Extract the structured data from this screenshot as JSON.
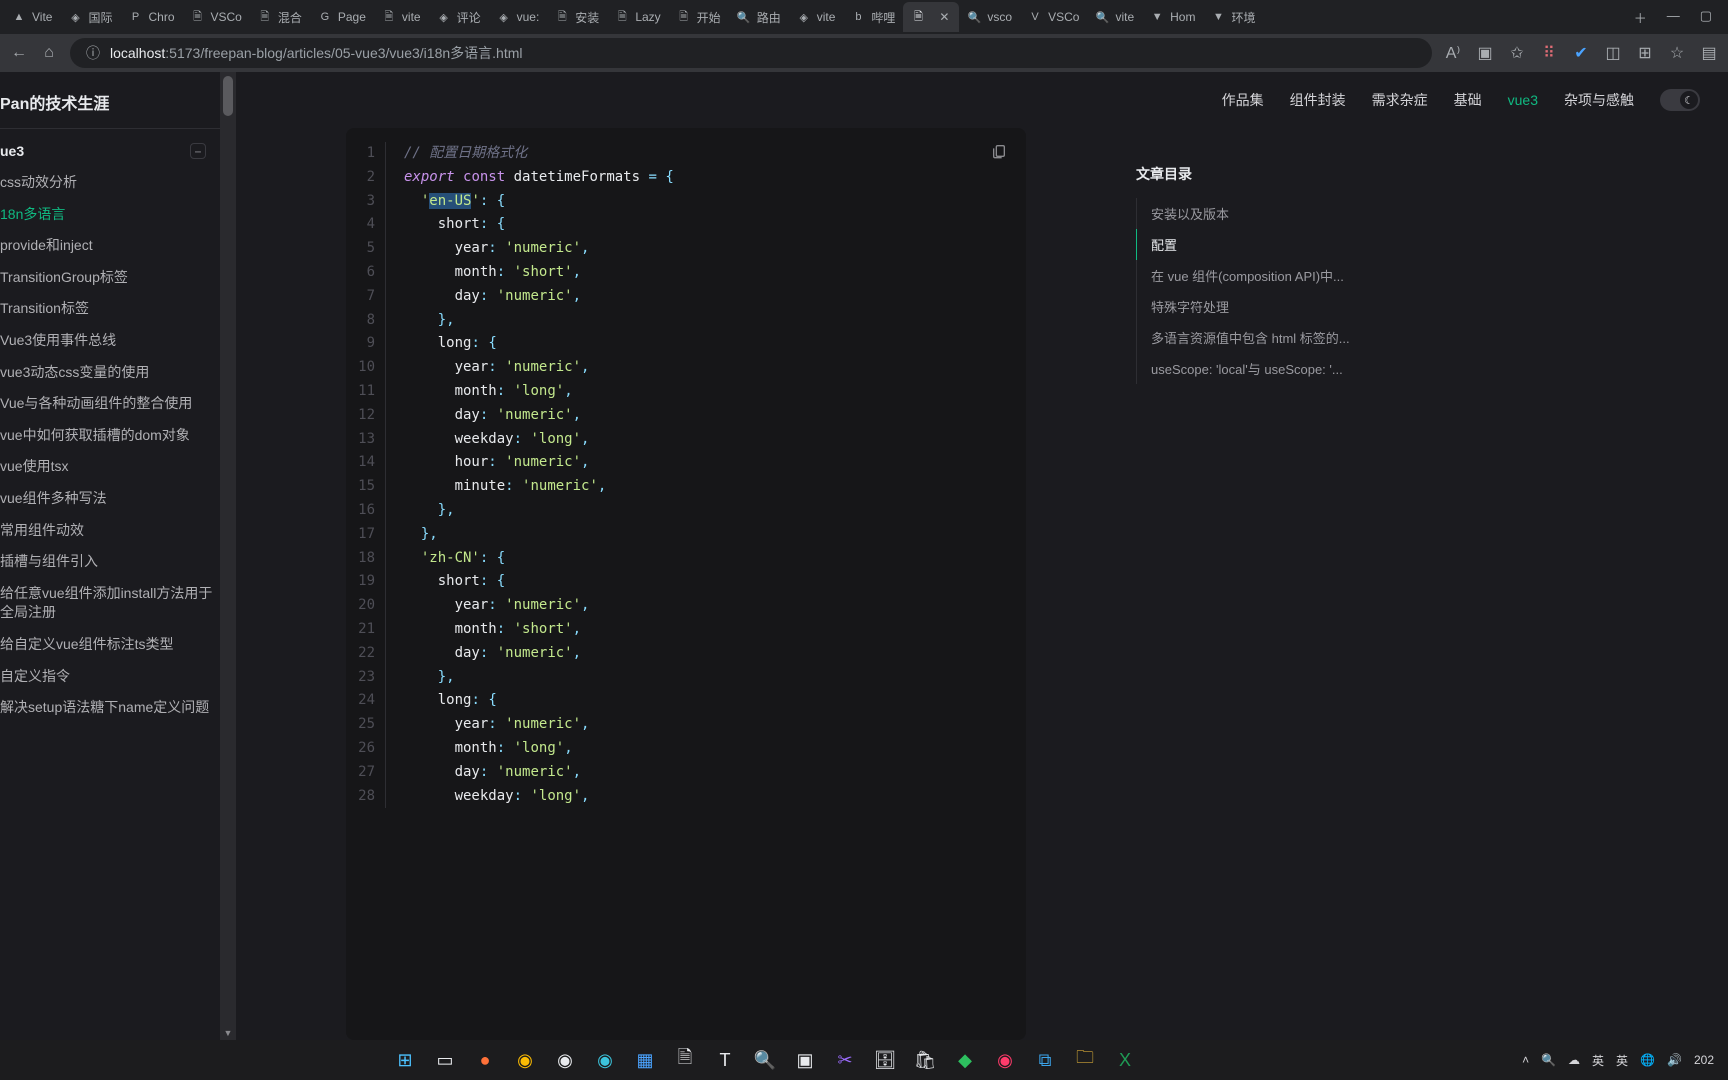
{
  "browser": {
    "tabs": [
      {
        "icon": "▲",
        "label": "Vite"
      },
      {
        "icon": "◈",
        "label": "国际"
      },
      {
        "icon": "P",
        "label": "Chro"
      },
      {
        "icon": "🗎",
        "label": "VSCo"
      },
      {
        "icon": "🗎",
        "label": "混合"
      },
      {
        "icon": "G",
        "label": "Page"
      },
      {
        "icon": "🗎",
        "label": "vite"
      },
      {
        "icon": "◈",
        "label": "评论"
      },
      {
        "icon": "◈",
        "label": "vue:"
      },
      {
        "icon": "🗎",
        "label": "安装"
      },
      {
        "icon": "🗎",
        "label": "Lazy"
      },
      {
        "icon": "🗎",
        "label": "开始"
      },
      {
        "icon": "🔍",
        "label": "路由"
      },
      {
        "icon": "◈",
        "label": "vite"
      },
      {
        "icon": "b",
        "label": "哔哩"
      },
      {
        "icon": "🗎",
        "label": "",
        "active": true,
        "closable": true
      },
      {
        "icon": "🔍",
        "label": "vsco"
      },
      {
        "icon": "V",
        "label": "VSCo"
      },
      {
        "icon": "🔍",
        "label": "vite"
      },
      {
        "icon": "▼",
        "label": "Hom"
      },
      {
        "icon": "▼",
        "label": "环境"
      }
    ],
    "url_host": "localhost",
    "url_port": ":5173",
    "url_path": "/freepan-blog/articles/05-vue3/vue3/i18n多语言.html"
  },
  "site_title": "Pan的技术生涯",
  "sidebar_group": "ue3",
  "sidebar_items": [
    "css动效分析",
    "18n多语言",
    "provide和inject",
    "TransitionGroup标签",
    "Transition标签",
    "Vue3使用事件总线",
    "vue3动态css变量的使用",
    "Vue与各种动画组件的整合使用",
    "vue中如何获取插槽的dom对象",
    "vue使用tsx",
    "vue组件多种写法",
    "常用组件动效",
    "插槽与组件引入",
    "给任意vue组件添加install方法用于全局注册",
    "给自定义vue组件标注ts类型",
    "自定义指令",
    "解决setup语法糖下name定义问题"
  ],
  "sidebar_active_index": 1,
  "topnav": [
    "作品集",
    "组件封装",
    "需求杂症",
    "基础",
    "vue3",
    "杂项与感触"
  ],
  "topnav_active_index": 4,
  "toc_title": "文章目录",
  "toc_items": [
    "安装以及版本",
    "配置",
    "在 vue 组件(composition API)中...",
    "特殊字符处理",
    "多语言资源值中包含 html 标签的...",
    "useScope: 'local'与 useScope: '..."
  ],
  "toc_active_index": 1,
  "code_lines": [
    {
      "n": 1,
      "segs": [
        {
          "t": "// 配置日期格式化",
          "c": "c-comment"
        }
      ]
    },
    {
      "n": 2,
      "segs": [
        {
          "t": "export",
          "c": "c-kw"
        },
        {
          "t": " "
        },
        {
          "t": "const",
          "c": "c-kw2"
        },
        {
          "t": " "
        },
        {
          "t": "datetimeFormats",
          "c": "c-id"
        },
        {
          "t": " "
        },
        {
          "t": "=",
          "c": "c-punct"
        },
        {
          "t": " "
        },
        {
          "t": "{",
          "c": "c-punct"
        }
      ]
    },
    {
      "n": 3,
      "segs": [
        {
          "t": "  "
        },
        {
          "t": "'",
          "c": "c-str"
        },
        {
          "t": "en-US",
          "c": "c-str c-sel"
        },
        {
          "t": "'",
          "c": "c-str"
        },
        {
          "t": ":",
          "c": "c-punct"
        },
        {
          "t": " "
        },
        {
          "t": "{",
          "c": "c-punct"
        }
      ]
    },
    {
      "n": 4,
      "segs": [
        {
          "t": "    "
        },
        {
          "t": "short",
          "c": "c-prop"
        },
        {
          "t": ":",
          "c": "c-punct"
        },
        {
          "t": " "
        },
        {
          "t": "{",
          "c": "c-punct"
        }
      ]
    },
    {
      "n": 5,
      "segs": [
        {
          "t": "      "
        },
        {
          "t": "year",
          "c": "c-prop"
        },
        {
          "t": ":",
          "c": "c-punct"
        },
        {
          "t": " "
        },
        {
          "t": "'numeric'",
          "c": "c-str"
        },
        {
          "t": ",",
          "c": "c-punct"
        }
      ]
    },
    {
      "n": 6,
      "segs": [
        {
          "t": "      "
        },
        {
          "t": "month",
          "c": "c-prop"
        },
        {
          "t": ":",
          "c": "c-punct"
        },
        {
          "t": " "
        },
        {
          "t": "'short'",
          "c": "c-str"
        },
        {
          "t": ",",
          "c": "c-punct"
        }
      ]
    },
    {
      "n": 7,
      "segs": [
        {
          "t": "      "
        },
        {
          "t": "day",
          "c": "c-prop"
        },
        {
          "t": ":",
          "c": "c-punct"
        },
        {
          "t": " "
        },
        {
          "t": "'numeric'",
          "c": "c-str"
        },
        {
          "t": ",",
          "c": "c-punct"
        }
      ]
    },
    {
      "n": 8,
      "segs": [
        {
          "t": "    "
        },
        {
          "t": "},",
          "c": "c-punct"
        }
      ]
    },
    {
      "n": 9,
      "segs": [
        {
          "t": "    "
        },
        {
          "t": "long",
          "c": "c-prop"
        },
        {
          "t": ":",
          "c": "c-punct"
        },
        {
          "t": " "
        },
        {
          "t": "{",
          "c": "c-punct"
        }
      ]
    },
    {
      "n": 10,
      "segs": [
        {
          "t": "      "
        },
        {
          "t": "year",
          "c": "c-prop"
        },
        {
          "t": ":",
          "c": "c-punct"
        },
        {
          "t": " "
        },
        {
          "t": "'numeric'",
          "c": "c-str"
        },
        {
          "t": ",",
          "c": "c-punct"
        }
      ]
    },
    {
      "n": 11,
      "segs": [
        {
          "t": "      "
        },
        {
          "t": "month",
          "c": "c-prop"
        },
        {
          "t": ":",
          "c": "c-punct"
        },
        {
          "t": " "
        },
        {
          "t": "'long'",
          "c": "c-str"
        },
        {
          "t": ",",
          "c": "c-punct"
        }
      ]
    },
    {
      "n": 12,
      "segs": [
        {
          "t": "      "
        },
        {
          "t": "day",
          "c": "c-prop"
        },
        {
          "t": ":",
          "c": "c-punct"
        },
        {
          "t": " "
        },
        {
          "t": "'numeric'",
          "c": "c-str"
        },
        {
          "t": ",",
          "c": "c-punct"
        }
      ]
    },
    {
      "n": 13,
      "segs": [
        {
          "t": "      "
        },
        {
          "t": "weekday",
          "c": "c-prop"
        },
        {
          "t": ":",
          "c": "c-punct"
        },
        {
          "t": " "
        },
        {
          "t": "'long'",
          "c": "c-str"
        },
        {
          "t": ",",
          "c": "c-punct"
        }
      ]
    },
    {
      "n": 14,
      "segs": [
        {
          "t": "      "
        },
        {
          "t": "hour",
          "c": "c-prop"
        },
        {
          "t": ":",
          "c": "c-punct"
        },
        {
          "t": " "
        },
        {
          "t": "'numeric'",
          "c": "c-str"
        },
        {
          "t": ",",
          "c": "c-punct"
        }
      ]
    },
    {
      "n": 15,
      "segs": [
        {
          "t": "      "
        },
        {
          "t": "minute",
          "c": "c-prop"
        },
        {
          "t": ":",
          "c": "c-punct"
        },
        {
          "t": " "
        },
        {
          "t": "'numeric'",
          "c": "c-str"
        },
        {
          "t": ",",
          "c": "c-punct"
        }
      ]
    },
    {
      "n": 16,
      "segs": [
        {
          "t": "    "
        },
        {
          "t": "},",
          "c": "c-punct"
        }
      ]
    },
    {
      "n": 17,
      "segs": [
        {
          "t": "  "
        },
        {
          "t": "},",
          "c": "c-punct"
        }
      ]
    },
    {
      "n": 18,
      "segs": [
        {
          "t": "  "
        },
        {
          "t": "'zh-CN'",
          "c": "c-str"
        },
        {
          "t": ":",
          "c": "c-punct"
        },
        {
          "t": " "
        },
        {
          "t": "{",
          "c": "c-punct"
        }
      ]
    },
    {
      "n": 19,
      "segs": [
        {
          "t": "    "
        },
        {
          "t": "short",
          "c": "c-prop"
        },
        {
          "t": ":",
          "c": "c-punct"
        },
        {
          "t": " "
        },
        {
          "t": "{",
          "c": "c-punct"
        }
      ]
    },
    {
      "n": 20,
      "segs": [
        {
          "t": "      "
        },
        {
          "t": "year",
          "c": "c-prop"
        },
        {
          "t": ":",
          "c": "c-punct"
        },
        {
          "t": " "
        },
        {
          "t": "'numeric'",
          "c": "c-str"
        },
        {
          "t": ",",
          "c": "c-punct"
        }
      ]
    },
    {
      "n": 21,
      "segs": [
        {
          "t": "      "
        },
        {
          "t": "month",
          "c": "c-prop"
        },
        {
          "t": ":",
          "c": "c-punct"
        },
        {
          "t": " "
        },
        {
          "t": "'short'",
          "c": "c-str"
        },
        {
          "t": ",",
          "c": "c-punct"
        }
      ]
    },
    {
      "n": 22,
      "segs": [
        {
          "t": "      "
        },
        {
          "t": "day",
          "c": "c-prop"
        },
        {
          "t": ":",
          "c": "c-punct"
        },
        {
          "t": " "
        },
        {
          "t": "'numeric'",
          "c": "c-str"
        },
        {
          "t": ",",
          "c": "c-punct"
        }
      ]
    },
    {
      "n": 23,
      "segs": [
        {
          "t": "    "
        },
        {
          "t": "},",
          "c": "c-punct"
        }
      ]
    },
    {
      "n": 24,
      "segs": [
        {
          "t": "    "
        },
        {
          "t": "long",
          "c": "c-prop"
        },
        {
          "t": ":",
          "c": "c-punct"
        },
        {
          "t": " "
        },
        {
          "t": "{",
          "c": "c-punct"
        }
      ]
    },
    {
      "n": 25,
      "segs": [
        {
          "t": "      "
        },
        {
          "t": "year",
          "c": "c-prop"
        },
        {
          "t": ":",
          "c": "c-punct"
        },
        {
          "t": " "
        },
        {
          "t": "'numeric'",
          "c": "c-str"
        },
        {
          "t": ",",
          "c": "c-punct"
        }
      ]
    },
    {
      "n": 26,
      "segs": [
        {
          "t": "      "
        },
        {
          "t": "month",
          "c": "c-prop"
        },
        {
          "t": ":",
          "c": "c-punct"
        },
        {
          "t": " "
        },
        {
          "t": "'long'",
          "c": "c-str"
        },
        {
          "t": ",",
          "c": "c-punct"
        }
      ]
    },
    {
      "n": 27,
      "segs": [
        {
          "t": "      "
        },
        {
          "t": "day",
          "c": "c-prop"
        },
        {
          "t": ":",
          "c": "c-punct"
        },
        {
          "t": " "
        },
        {
          "t": "'numeric'",
          "c": "c-str"
        },
        {
          "t": ",",
          "c": "c-punct"
        }
      ]
    },
    {
      "n": 28,
      "segs": [
        {
          "t": "      "
        },
        {
          "t": "weekday",
          "c": "c-prop"
        },
        {
          "t": ":",
          "c": "c-punct"
        },
        {
          "t": " "
        },
        {
          "t": "'long'",
          "c": "c-str"
        },
        {
          "t": ",",
          "c": "c-punct"
        }
      ]
    }
  ],
  "tray": {
    "ime1": "英",
    "ime2": "英",
    "year": "202"
  }
}
